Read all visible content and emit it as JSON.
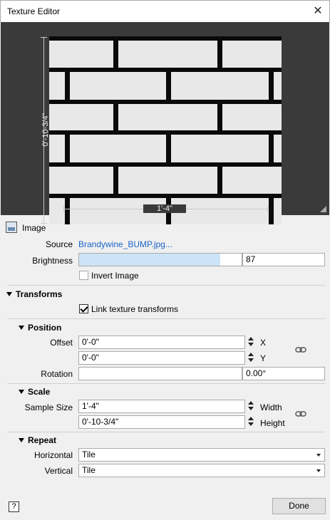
{
  "window": {
    "title": "Texture Editor",
    "close_glyph": "✕"
  },
  "preview": {
    "height_label": "0'-10-3/4\"",
    "width_label": "1'-4\""
  },
  "image": {
    "header": "Image",
    "source_label": "Source",
    "source_value": "Brandywine_BUMP.jpg...",
    "brightness_label": "Brightness",
    "brightness_value": "87",
    "brightness_fraction": 0.87,
    "invert_label": "Invert Image",
    "invert_checked": false
  },
  "transforms": {
    "header": "Transforms",
    "link_label": "Link texture transforms",
    "link_checked": true
  },
  "position": {
    "header": "Position",
    "offset_label": "Offset",
    "offset_x": "0'-0\"",
    "offset_y": "0'-0\"",
    "x_label": "X",
    "y_label": "Y",
    "rotation_label": "Rotation",
    "rotation_value": "0.00°"
  },
  "scale": {
    "header": "Scale",
    "sample_label": "Sample Size",
    "width_value": "1'-4\"",
    "height_value": "0'-10-3/4\"",
    "width_label": "Width",
    "height_label": "Height"
  },
  "repeat": {
    "header": "Repeat",
    "horizontal_label": "Horizontal",
    "horizontal_value": "Tile",
    "vertical_label": "Vertical",
    "vertical_value": "Tile"
  },
  "footer": {
    "help_glyph": "?",
    "done_label": "Done"
  },
  "colors": {
    "link": "#1a64c8",
    "slider_fill": "#cce4f7",
    "preview_bg": "#3a3a3a"
  }
}
